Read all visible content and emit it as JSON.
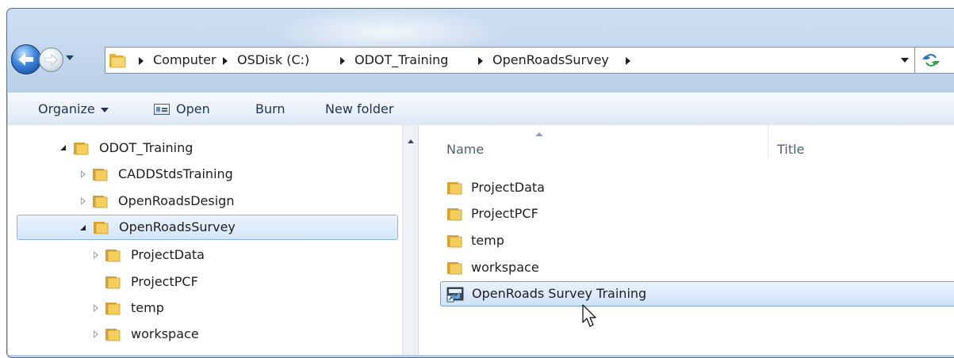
{
  "address_bar": {
    "crumbs": [
      "Computer",
      "OSDisk (C:)",
      "ODOT_Training",
      "OpenRoadsSurvey"
    ]
  },
  "toolbar": {
    "organize_label": "Organize",
    "open_label": "Open",
    "burn_label": "Burn",
    "new_folder_label": "New folder"
  },
  "nav_tree": {
    "items": [
      {
        "label": "ODOT_Training",
        "state": "expanded"
      },
      {
        "label": "CADDStdsTraining",
        "state": "collapsed"
      },
      {
        "label": "OpenRoadsDesign",
        "state": "collapsed"
      },
      {
        "label": "OpenRoadsSurvey",
        "state": "expanded",
        "selected": true
      },
      {
        "label": "ProjectData",
        "state": "collapsed"
      },
      {
        "label": "ProjectPCF",
        "state": "none"
      },
      {
        "label": "temp",
        "state": "collapsed"
      },
      {
        "label": "workspace",
        "state": "collapsed"
      }
    ]
  },
  "file_list": {
    "columns": [
      "Name",
      "Title"
    ],
    "items": [
      {
        "name": "ProjectData",
        "type": "folder"
      },
      {
        "name": "ProjectPCF",
        "type": "folder"
      },
      {
        "name": "temp",
        "type": "folder"
      },
      {
        "name": "workspace",
        "type": "folder"
      },
      {
        "name": "OpenRoads Survey Training",
        "type": "shortcut",
        "selected": true
      }
    ]
  },
  "colors": {
    "accent": "#3e86d8",
    "selection_border": "#8ab4e6",
    "folder": "#f0c24a"
  }
}
